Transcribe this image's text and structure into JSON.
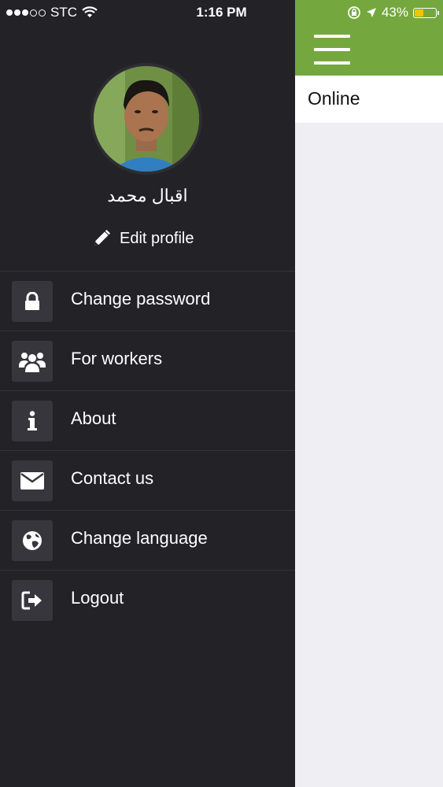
{
  "status_bar": {
    "carrier": "STC",
    "time": "1:16 PM",
    "battery_percent": "43%",
    "battery_level": 0.43,
    "signal_bars_filled": 3,
    "signal_bars_total": 5
  },
  "drawer": {
    "user_name": "اقبال محمد",
    "edit_profile_label": "Edit profile",
    "menu": [
      {
        "label": "Change password",
        "icon": "lock-icon"
      },
      {
        "label": "For workers",
        "icon": "users-icon"
      },
      {
        "label": "About",
        "icon": "info-icon"
      },
      {
        "label": "Contact us",
        "icon": "envelope-icon"
      },
      {
        "label": "Change language",
        "icon": "globe-icon"
      },
      {
        "label": "Logout",
        "icon": "logout-icon"
      }
    ]
  },
  "main": {
    "status_label": "Online"
  },
  "colors": {
    "drawer_bg": "#232227",
    "header_green": "#74a83f",
    "battery_yellow": "#f5c400",
    "content_bg": "#efeef3"
  }
}
